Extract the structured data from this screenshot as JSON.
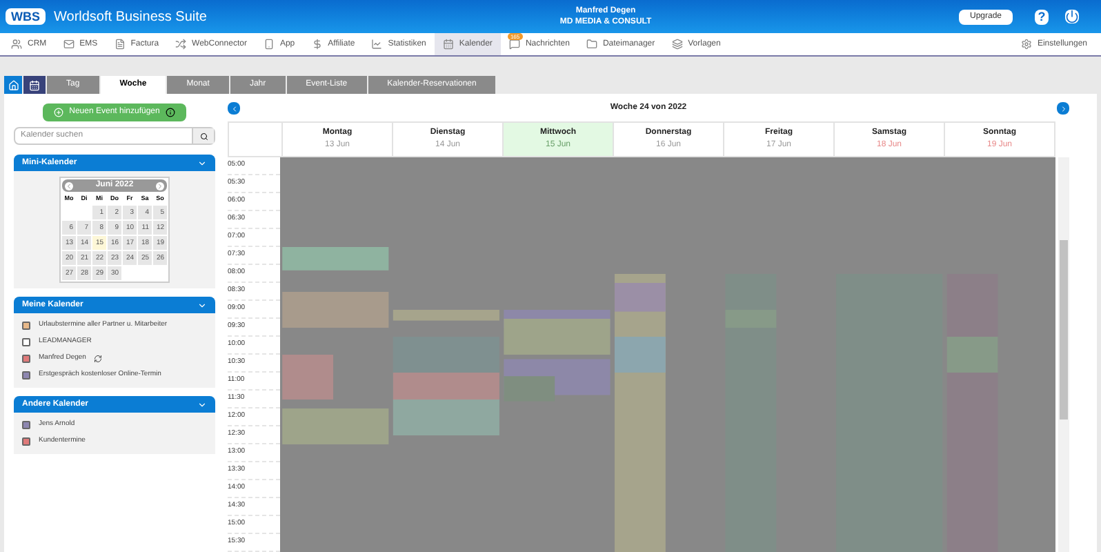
{
  "header": {
    "logo": "WBS",
    "title": "Worldsoft Business Suite",
    "user": "Manfred Degen",
    "company": "MD MEDIA & CONSULT",
    "upgrade": "Upgrade",
    "help": "?"
  },
  "nav": [
    {
      "label": "CRM",
      "selected": false
    },
    {
      "label": "EMS",
      "selected": false
    },
    {
      "label": "Factura",
      "selected": false
    },
    {
      "label": "WebConnector",
      "selected": false
    },
    {
      "label": "App",
      "selected": false
    },
    {
      "label": "Affiliate",
      "selected": false
    },
    {
      "label": "Statistiken",
      "selected": false
    },
    {
      "label": "Kalender",
      "selected": true
    },
    {
      "label": "Nachrichten",
      "selected": false,
      "badge": "165"
    },
    {
      "label": "Dateimanager",
      "selected": false
    },
    {
      "label": "Vorlagen",
      "selected": false
    }
  ],
  "settings": "Einstellungen",
  "tabs": [
    {
      "label": "Tag",
      "selected": false
    },
    {
      "label": "Woche",
      "selected": true
    },
    {
      "label": "Monat",
      "selected": false
    },
    {
      "label": "Jahr",
      "selected": false
    },
    {
      "label": "Event-Liste",
      "selected": false
    },
    {
      "label": "Kalender-Reservationen",
      "selected": false
    }
  ],
  "sidebar": {
    "add_button": "Neuen Event hinzufügen",
    "search": {
      "placeholder": "Kalender suchen"
    },
    "mini_calendar": {
      "title": "Mini-Kalender",
      "month": "Juni 2022",
      "weekdays": [
        "Mo",
        "Di",
        "Mi",
        "Do",
        "Fr",
        "Sa",
        "So"
      ],
      "weeks": [
        [
          {
            "kind": "blank"
          },
          {
            "kind": "blank"
          },
          {
            "day": "1",
            "today": false
          },
          {
            "day": "2",
            "today": false
          },
          {
            "day": "3",
            "today": false
          },
          {
            "day": "4",
            "today": false
          },
          {
            "day": "5",
            "today": false
          }
        ],
        [
          {
            "day": "6",
            "today": false
          },
          {
            "day": "7",
            "today": false
          },
          {
            "day": "8",
            "today": false
          },
          {
            "day": "9",
            "today": false
          },
          {
            "day": "10",
            "today": false
          },
          {
            "day": "11",
            "today": false
          },
          {
            "day": "12",
            "today": false
          }
        ],
        [
          {
            "day": "13",
            "today": false
          },
          {
            "day": "14",
            "today": false
          },
          {
            "day": "15",
            "today": true
          },
          {
            "day": "16",
            "today": false
          },
          {
            "day": "17",
            "today": false
          },
          {
            "day": "18",
            "today": false
          },
          {
            "day": "19",
            "today": false
          }
        ],
        [
          {
            "day": "20",
            "today": false
          },
          {
            "day": "21",
            "today": false
          },
          {
            "day": "22",
            "today": false
          },
          {
            "day": "23",
            "today": false
          },
          {
            "day": "24",
            "today": false
          },
          {
            "day": "25",
            "today": false
          },
          {
            "day": "26",
            "today": false
          }
        ],
        [
          {
            "day": "27",
            "today": false
          },
          {
            "day": "28",
            "today": false
          },
          {
            "day": "29",
            "today": false
          },
          {
            "day": "30",
            "today": false
          },
          {
            "kind": "blank"
          },
          {
            "kind": "blank"
          },
          {
            "kind": "blank"
          }
        ]
      ]
    },
    "my_calendars": {
      "title": "Meine Kalender",
      "items": [
        {
          "label": "Urlaubstermine aller Partner u. Mitarbeiter",
          "color": "#e8b98a",
          "sync": false
        },
        {
          "label": "LEADMANAGER",
          "color": "#ffffff",
          "sync": false
        },
        {
          "label": "Manfred Degen",
          "color": "#e07a7a",
          "sync": true
        },
        {
          "label": "Erstgespräch kostenloser Online-Termin",
          "color": "#8d86b0",
          "sync": false
        }
      ]
    },
    "other_calendars": {
      "title": "Andere Kalender",
      "items": [
        {
          "label": "Jens Arnold",
          "color": "#8d86b0"
        },
        {
          "label": "Kundentermine",
          "color": "#e07a7a"
        }
      ]
    }
  },
  "week": {
    "title": "Woche 24 von 2022",
    "days": [
      {
        "name": "Montag",
        "date": "13 Jun",
        "selected": false,
        "weekend": false
      },
      {
        "name": "Dienstag",
        "date": "14 Jun",
        "selected": false,
        "weekend": false
      },
      {
        "name": "Mittwoch",
        "date": "15 Jun",
        "selected": true,
        "weekend": false
      },
      {
        "name": "Donnerstag",
        "date": "16 Jun",
        "selected": false,
        "weekend": false
      },
      {
        "name": "Freitag",
        "date": "17 Jun",
        "selected": false,
        "weekend": false
      },
      {
        "name": "Samstag",
        "date": "18 Jun",
        "selected": false,
        "weekend": true
      },
      {
        "name": "Sonntag",
        "date": "19 Jun",
        "selected": false,
        "weekend": true
      }
    ],
    "times": [
      "05:00",
      "05:30",
      "06:00",
      "06:30",
      "07:00",
      "07:30",
      "08:00",
      "08:30",
      "09:00",
      "09:30",
      "10:00",
      "10:30",
      "11:00",
      "11:30",
      "12:00",
      "12:30",
      "13:00",
      "13:30",
      "14:00",
      "14:30",
      "15:00",
      "15:30"
    ]
  }
}
